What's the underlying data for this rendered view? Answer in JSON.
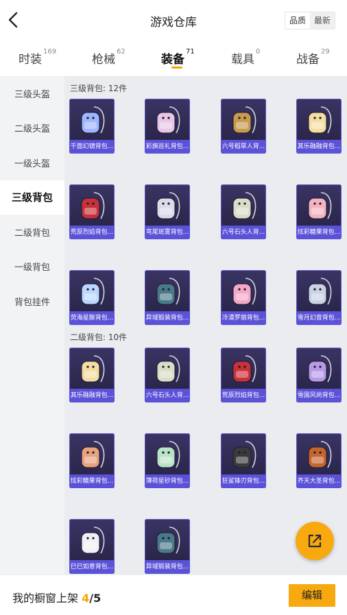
{
  "header": {
    "title": "游戏仓库",
    "back_icon": "chevron-left-icon",
    "sort_options": [
      "品质",
      "最新"
    ],
    "sort_selected": "品质"
  },
  "tabs": [
    {
      "label": "时装",
      "count": "169"
    },
    {
      "label": "枪械",
      "count": "62"
    },
    {
      "label": "装备",
      "count": "71"
    },
    {
      "label": "载具",
      "count": "0"
    },
    {
      "label": "战备",
      "count": "29"
    }
  ],
  "active_tab": "装备",
  "sidebar": [
    {
      "label": "三级头盔"
    },
    {
      "label": "二级头盔"
    },
    {
      "label": "一级头盔"
    },
    {
      "label": "三级背包"
    },
    {
      "label": "二级背包"
    },
    {
      "label": "一级背包"
    },
    {
      "label": "背包挂件"
    }
  ],
  "active_category": "三级背包",
  "sections": [
    {
      "title": "三级背包: 12件",
      "items": [
        {
          "name": "千面幻镜背包...",
          "color": "#9fb6ff"
        },
        {
          "name": "彩旗巡礼背包...",
          "color": "#e7c6e6"
        },
        {
          "name": "六号稻草人背...",
          "color": "#c79a4d"
        },
        {
          "name": "其乐融融背包...",
          "color": "#f3dda0"
        },
        {
          "name": "荒原烈焰背包...",
          "color": "#c8313a"
        },
        {
          "name": "弯尾斑雾背包...",
          "color": "#d9dbe8"
        },
        {
          "name": "六号石头人背...",
          "color": "#d9ddc7"
        },
        {
          "name": "炫彩糖果背包...",
          "color": "#f3b3c0"
        },
        {
          "name": "荧海星豚背包...",
          "color": "#bcd6ff"
        },
        {
          "name": "异域锻装背包...",
          "color": "#4a7a8a"
        },
        {
          "name": "冷漠罗丽背包...",
          "color": "#f2a9c6"
        },
        {
          "name": "雪月幻音背包...",
          "color": "#c9d3e3"
        }
      ]
    },
    {
      "title": "二级背包: 10件",
      "items": [
        {
          "name": "其乐融融背包...",
          "color": "#f3dda0"
        },
        {
          "name": "六号石头人背...",
          "color": "#d9ddc7"
        },
        {
          "name": "荒原烈焰背包...",
          "color": "#c8313a"
        },
        {
          "name": "雪国风尚背包...",
          "color": "#b59be6"
        },
        {
          "name": "炫彩糖果背包...",
          "color": "#e8a27d"
        },
        {
          "name": "薄荷星砂背包...",
          "color": "#b8e3c6"
        },
        {
          "name": "狂鲨锋刃背包...",
          "color": "#3a3a3a"
        },
        {
          "name": "齐天大圣背包...",
          "color": "#c5652d"
        },
        {
          "name": "巳巳如意背包...",
          "color": "#f1f1f5"
        },
        {
          "name": "异域锻装背包...",
          "color": "#4a7a8a"
        }
      ]
    }
  ],
  "fab_icon": "share-external-icon",
  "footer": {
    "label": "我的橱窗上架",
    "current": "4",
    "separator": "/",
    "total": "5",
    "edit_label": "编辑"
  },
  "colors": {
    "accent": "#f7a90f",
    "card_label_bg": "#5b52d8",
    "card_bg": "#2b2548"
  }
}
